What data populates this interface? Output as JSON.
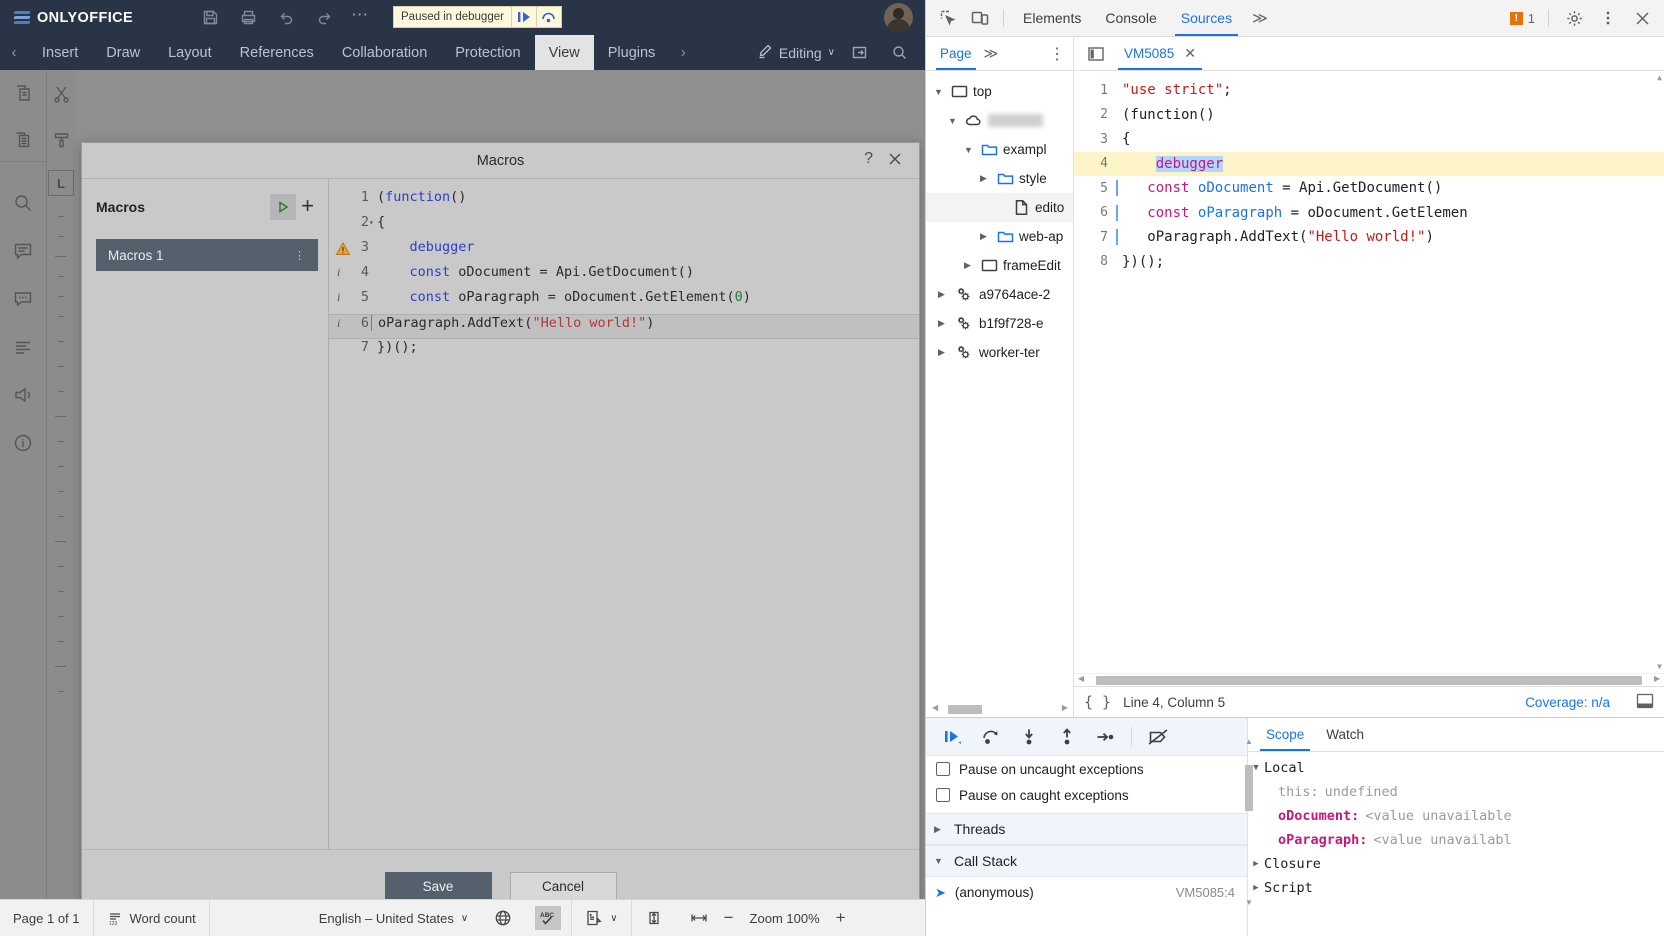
{
  "onlyoffice": {
    "brand": "ONLYOFFICE",
    "quick_access": [
      "save-icon",
      "print-icon",
      "undo-icon",
      "redo-icon"
    ],
    "overflow_label": "⋯",
    "debugger_banner": {
      "text": "Paused in debugger",
      "resume_icon": "resume-script-icon",
      "step_icon": "step-over-icon"
    },
    "tabs": {
      "prev_arrow": "‹",
      "next_arrow": "›",
      "items": [
        {
          "label": "Insert",
          "active": false
        },
        {
          "label": "Draw",
          "active": false
        },
        {
          "label": "Layout",
          "active": false
        },
        {
          "label": "References",
          "active": false
        },
        {
          "label": "Collaboration",
          "active": false
        },
        {
          "label": "Protection",
          "active": false
        },
        {
          "label": "View",
          "active": true
        },
        {
          "label": "Plugins",
          "active": false
        }
      ],
      "editing_mode": "Editing",
      "editing_caret": "∨"
    },
    "left_rail_icons": [
      "copy-icon",
      "cut-icon",
      "paste-icon",
      "format-painter-icon",
      "search-icon",
      "comments-icon",
      "chat-icon",
      "paragraph-marks-icon",
      "feedback-icon",
      "about-icon"
    ],
    "ruler_corner_label": "L",
    "status_bar": {
      "page_label": "Page 1 of 1",
      "word_count": "Word count",
      "word_count_icon": "word-count-icon",
      "language": "English – United States",
      "language_caret": "∨",
      "globe_icon": "set-language-icon",
      "spellcheck_icon": "spell-checking-icon",
      "track_changes_icon": "track-changes-icon",
      "track_changes_caret": "∨",
      "fit_page_icon": "fit-to-page-icon",
      "fit_width_icon": "fit-to-width-icon",
      "zoom_out": "−",
      "zoom_label": "Zoom 100%",
      "zoom_in": "+"
    }
  },
  "macros_dialog": {
    "title": "Macros",
    "help_icon": "?",
    "close_icon": "close-icon",
    "list_header": "Macros",
    "run_icon": "run-macro-icon",
    "add_icon": "+",
    "items": [
      {
        "name": "Macros 1",
        "kebab": "⋮",
        "selected": true
      }
    ],
    "code_lines": [
      {
        "n": "1",
        "marker": "",
        "fold": "",
        "text": "(function()"
      },
      {
        "n": "2",
        "marker": "",
        "fold": "▾",
        "text": "{"
      },
      {
        "n": "3",
        "marker": "warning",
        "fold": "",
        "text": "    debugger"
      },
      {
        "n": "4",
        "marker": "i",
        "fold": "",
        "text": "    const oDocument = Api.GetDocument()"
      },
      {
        "n": "5",
        "marker": "i",
        "fold": "",
        "text": "    const oParagraph = oDocument.GetElement(0)"
      },
      {
        "n": "6",
        "marker": "i",
        "fold": "",
        "text": "    oParagraph.AddText(\"Hello world!\")"
      },
      {
        "n": "7",
        "marker": "",
        "fold": "",
        "text": "})();"
      }
    ],
    "save_label": "Save",
    "cancel_label": "Cancel"
  },
  "devtools": {
    "toolbar": {
      "inspect_icon": "inspect-element-icon",
      "device_icon": "device-toolbar-icon",
      "tabs": [
        {
          "label": "Elements",
          "active": false
        },
        {
          "label": "Console",
          "active": false
        },
        {
          "label": "Sources",
          "active": true
        }
      ],
      "more_tabs": "≫",
      "error_count": "1",
      "error_icon": "error-badge-icon",
      "settings_icon": "gear-icon",
      "kebab_icon": "more-options-icon",
      "close_icon": "close-icon"
    },
    "navigator": {
      "tab_label": "Page",
      "more_icon": "≫",
      "kebab_icon": "⋮",
      "tree": [
        {
          "depth": 0,
          "twisty": "▼",
          "icon": "frame-icon",
          "label": "top"
        },
        {
          "depth": 1,
          "twisty": "▼",
          "icon": "cloud-icon",
          "label": "",
          "blurred": true
        },
        {
          "depth": 2,
          "twisty": "▼",
          "icon": "folder-icon",
          "label": "exampl"
        },
        {
          "depth": 3,
          "twisty": "▶",
          "icon": "folder-icon",
          "label": "style"
        },
        {
          "depth": 4,
          "twisty": "",
          "icon": "file-icon",
          "label": "edito",
          "selected": true
        },
        {
          "depth": 3,
          "twisty": "▶",
          "icon": "folder-icon",
          "label": "web-ap"
        },
        {
          "depth": 2,
          "twisty": "▶",
          "icon": "frame-icon",
          "label": "frameEdit"
        },
        {
          "depth": 1,
          "twisty": "▶",
          "icon": "worker-icon",
          "label": "a9764ace-2"
        },
        {
          "depth": 1,
          "twisty": "▶",
          "icon": "worker-icon",
          "label": "b1f9f728-e"
        },
        {
          "depth": 1,
          "twisty": "▶",
          "icon": "worker-icon",
          "label": "worker-ter"
        }
      ]
    },
    "editor": {
      "panel_toggle_icon": "show-navigator-icon",
      "file_tab": "VM5085",
      "file_tab_close": "✕",
      "lines": [
        {
          "n": "1",
          "text": "\"use strict\";",
          "type": "string"
        },
        {
          "n": "2",
          "text": "(function()",
          "type": "plain"
        },
        {
          "n": "3",
          "text": "{",
          "type": "plain"
        },
        {
          "n": "4",
          "text": "    debugger",
          "type": "debugger",
          "highlighted": true,
          "selection": "debugger"
        },
        {
          "n": "5",
          "text": "    const oDocument = Api.GetDocument()",
          "type": "const"
        },
        {
          "n": "6",
          "text": "    const oParagraph = oDocument.GetElemen",
          "type": "const"
        },
        {
          "n": "7",
          "text": "    oParagraph.AddText(\"Hello world!\")",
          "type": "call"
        },
        {
          "n": "8",
          "text": "})();",
          "type": "plain"
        }
      ],
      "status": {
        "format_icon": "{ }",
        "position": "Line 4, Column 5",
        "coverage": "Coverage: n/a",
        "dock_icon": "show-drawer-icon"
      }
    },
    "debugger": {
      "controls": [
        "resume-script-icon",
        "step-over-icon",
        "step-into-icon",
        "step-out-icon",
        "step-icon",
        "deactivate-breakpoints-icon"
      ],
      "checkboxes": [
        {
          "label": "Pause on uncaught exceptions",
          "checked": false
        },
        {
          "label": "Pause on caught exceptions",
          "checked": false
        }
      ],
      "sections": [
        {
          "label": "Threads",
          "expanded": false,
          "twisty": "▶"
        },
        {
          "label": "Call Stack",
          "expanded": true,
          "twisty": "▼"
        }
      ],
      "call_stack": [
        {
          "marker": "➤",
          "name": "(anonymous)",
          "location": "VM5085:4"
        }
      ],
      "side_tabs": [
        {
          "label": "Scope",
          "active": true
        },
        {
          "label": "Watch",
          "active": false
        }
      ],
      "scope": [
        {
          "indent": 0,
          "twisty": "▼",
          "name": "Local",
          "value": "",
          "kind": "section"
        },
        {
          "indent": 1,
          "twisty": "",
          "name": "this:",
          "value": "undefined",
          "kind": "dim"
        },
        {
          "indent": 1,
          "twisty": "",
          "name": "oDocument:",
          "value": "<value unavailable",
          "kind": "prop"
        },
        {
          "indent": 1,
          "twisty": "",
          "name": "oParagraph:",
          "value": "<value unavailabl",
          "kind": "prop"
        },
        {
          "indent": 0,
          "twisty": "▶",
          "name": "Closure",
          "value": "",
          "kind": "section"
        },
        {
          "indent": 0,
          "twisty": "▶",
          "name": "Script",
          "value": "",
          "kind": "section"
        }
      ]
    }
  },
  "colors": {
    "oo_header": "#2a3447",
    "accent_blue": "#1a73e8",
    "highlight_yellow": "#fdf4c8",
    "selection_blue": "#b3d4fc",
    "error_orange": "#e8710a",
    "dialog_gray": "#c9c9c9",
    "macro_item": "#55606d"
  }
}
